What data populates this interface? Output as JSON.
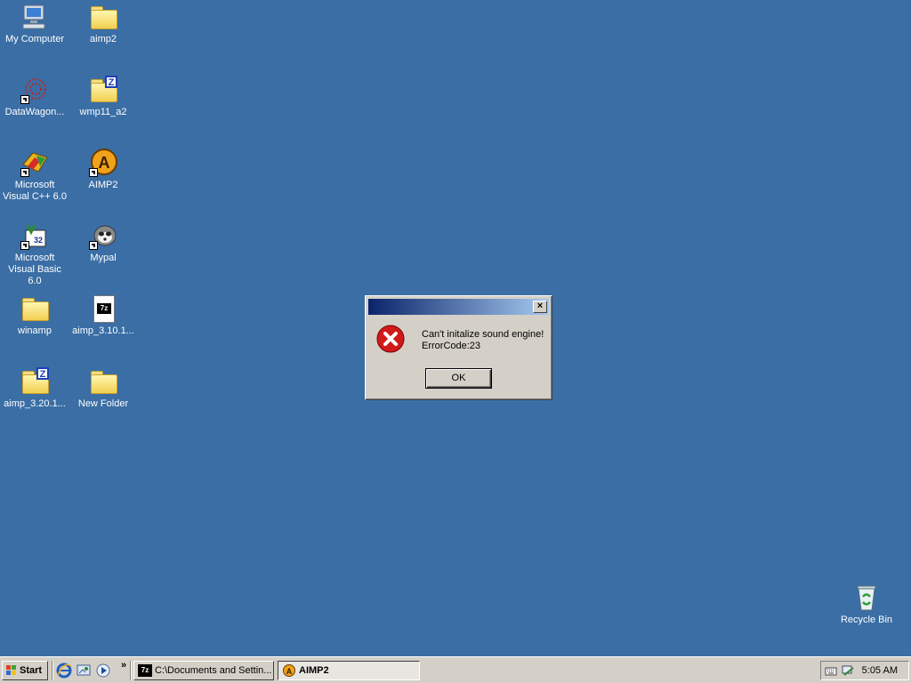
{
  "desktop": {
    "icons": [
      {
        "label": "My Computer"
      },
      {
        "label": "aimp2"
      },
      {
        "label": "DataWagon..."
      },
      {
        "label": "wmp11_a2"
      },
      {
        "label": "Microsoft Visual C++ 6.0"
      },
      {
        "label": "AIMP2"
      },
      {
        "label": "Microsoft Visual Basic 6.0"
      },
      {
        "label": "Mypal"
      },
      {
        "label": "winamp"
      },
      {
        "label": "aimp_3.10.1..."
      },
      {
        "label": "aimp_3.20.1..."
      },
      {
        "label": "New Folder"
      },
      {
        "label": "Recycle Bin"
      }
    ]
  },
  "dialog": {
    "title": "",
    "close_glyph": "×",
    "message_line1": "Can't initalize sound engine!",
    "message_line2": "ErrorCode:23",
    "ok_label": "OK"
  },
  "taskbar": {
    "start_label": "Start",
    "chevron": "»",
    "tasks": [
      {
        "label": "C:\\Documents and Settin..."
      },
      {
        "label": "AIMP2"
      }
    ],
    "clock": "5:05 AM"
  },
  "colors": {
    "desktop_bg": "#3a6ea5",
    "taskbar_bg": "#d4d0c8",
    "titlebar_start": "#0a246a",
    "titlebar_end": "#a6caf0"
  }
}
